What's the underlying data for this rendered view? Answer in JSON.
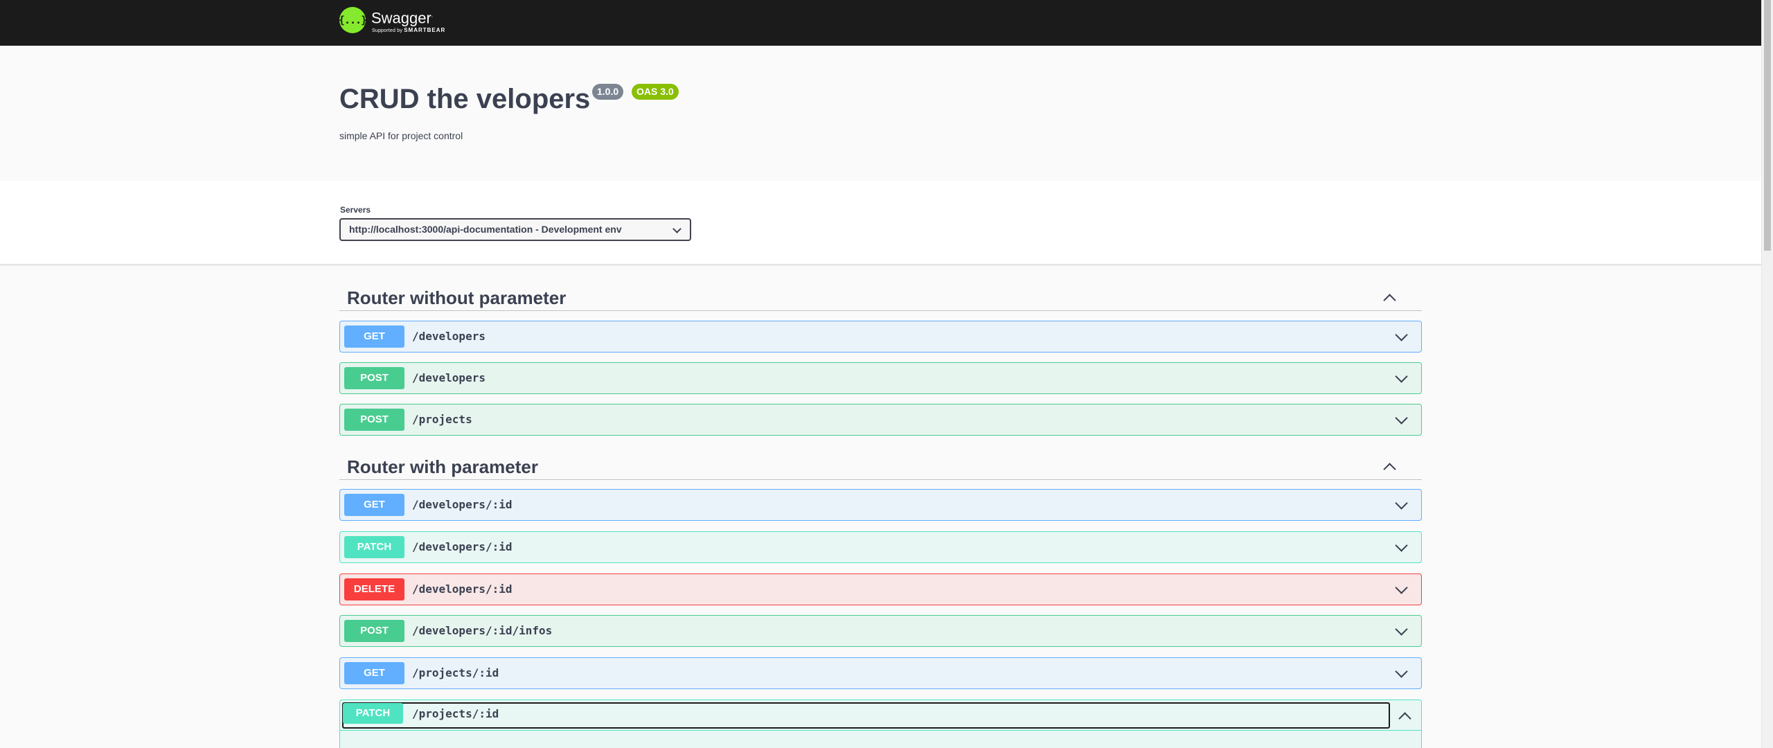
{
  "topbar": {
    "logo_symbol": "{...}",
    "logo_name": "Swagger",
    "logo_tm": ".",
    "logo_sub_prefix": "Supported by ",
    "logo_sub_brand": "SMARTBEAR"
  },
  "info": {
    "title": "CRUD the velopers",
    "version": "1.0.0",
    "oas": "OAS 3.0",
    "description": "simple API for project control"
  },
  "servers": {
    "label": "Servers",
    "selected": "http://localhost:3000/api-documentation - Development env"
  },
  "tags": [
    {
      "name": "Router without parameter",
      "operations": [
        {
          "method": "GET",
          "path": "/developers"
        },
        {
          "method": "POST",
          "path": "/developers"
        },
        {
          "method": "POST",
          "path": "/projects"
        }
      ]
    },
    {
      "name": "Router with parameter",
      "operations": [
        {
          "method": "GET",
          "path": "/developers/:id"
        },
        {
          "method": "PATCH",
          "path": "/developers/:id"
        },
        {
          "method": "DELETE",
          "path": "/developers/:id"
        },
        {
          "method": "POST",
          "path": "/developers/:id/infos"
        },
        {
          "method": "GET",
          "path": "/projects/:id"
        },
        {
          "method": "PATCH",
          "path": "/projects/:id"
        }
      ]
    }
  ],
  "colors": {
    "get": "#61affe",
    "post": "#49cc90",
    "patch": "#50e3c2",
    "delete": "#f93e3e",
    "topbar": "#1b1b1b",
    "logo": "#85ea2d"
  },
  "icons": {
    "tag_toggle": "chevron-up-icon",
    "op_toggle": "chevron-down-icon",
    "select_arrow": "chevron-down-icon"
  }
}
